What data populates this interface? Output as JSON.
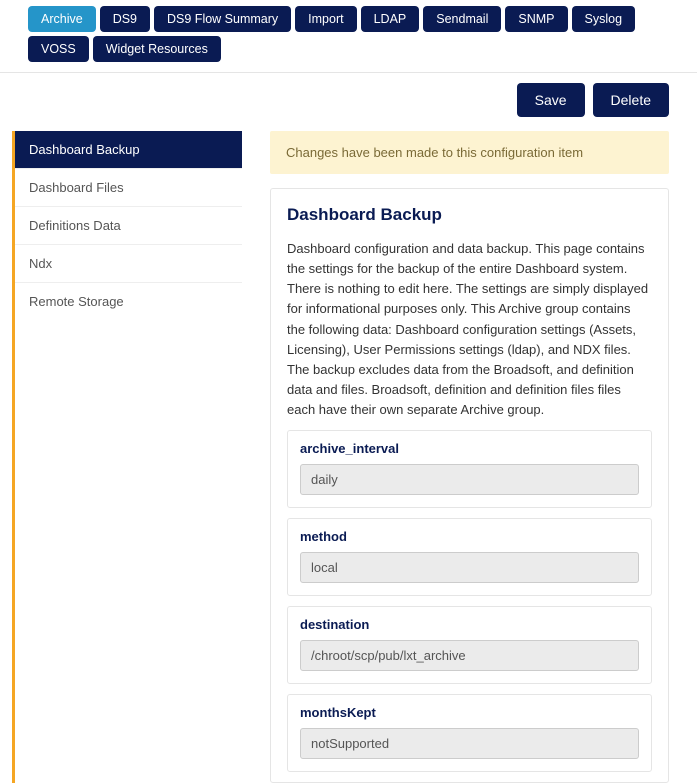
{
  "tabs": [
    {
      "label": "Archive",
      "active": true
    },
    {
      "label": "DS9",
      "active": false
    },
    {
      "label": "DS9 Flow Summary",
      "active": false
    },
    {
      "label": "Import",
      "active": false
    },
    {
      "label": "LDAP",
      "active": false
    },
    {
      "label": "Sendmail",
      "active": false
    },
    {
      "label": "SNMP",
      "active": false
    },
    {
      "label": "Syslog",
      "active": false
    },
    {
      "label": "VOSS",
      "active": false
    },
    {
      "label": "Widget Resources",
      "active": false
    }
  ],
  "actions": {
    "save": "Save",
    "delete": "Delete"
  },
  "sidebar": [
    {
      "label": "Dashboard Backup",
      "active": true
    },
    {
      "label": "Dashboard Files",
      "active": false
    },
    {
      "label": "Definitions Data",
      "active": false
    },
    {
      "label": "Ndx",
      "active": false
    },
    {
      "label": "Remote Storage",
      "active": false
    }
  ],
  "banner": "Changes have been made to this configuration item",
  "card": {
    "title": "Dashboard Backup",
    "description": "Dashboard configuration and data backup. This page contains the settings for the backup of the entire Dashboard system. There is nothing to edit here. The settings are simply displayed for informational purposes only. This Archive group contains the following data: Dashboard configuration settings (Assets, Licensing), User Permissions settings (ldap), and NDX files. The backup excludes data from the Broadsoft, and definition data and files. Broadsoft, definition and definition files files each have their own separate Archive group.",
    "fields": [
      {
        "key": "archive_interval",
        "value": "daily"
      },
      {
        "key": "method",
        "value": "local"
      },
      {
        "key": "destination",
        "value": "/chroot/scp/pub/lxt_archive"
      },
      {
        "key": "monthsKept",
        "value": "notSupported"
      }
    ]
  }
}
